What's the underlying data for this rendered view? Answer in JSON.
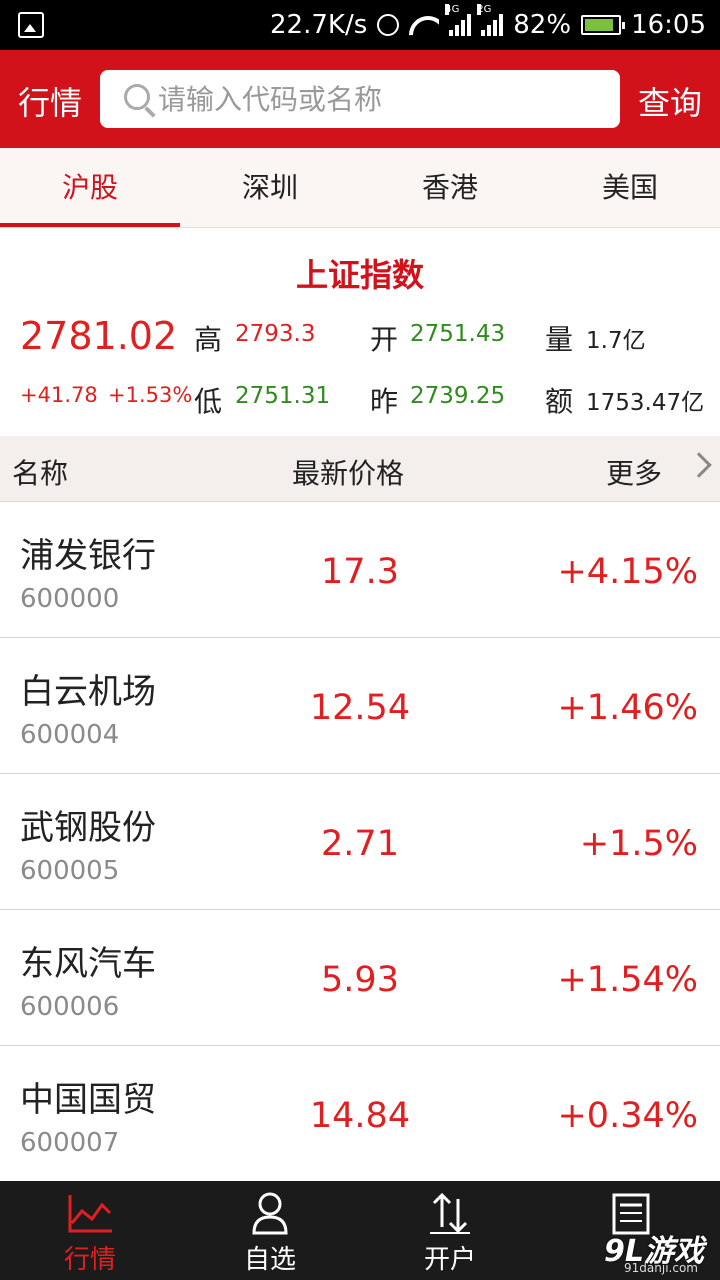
{
  "status_bar": {
    "speed": "22.7K/s",
    "net1": "4G",
    "net2": "2G",
    "battery": "82%",
    "time": "16:05"
  },
  "header": {
    "title": "行情",
    "search_placeholder": "请输入代码或名称",
    "query_label": "查询",
    "accent_color": "#d1121b"
  },
  "tabs": [
    {
      "label": "沪股",
      "active": true
    },
    {
      "label": "深圳",
      "active": false
    },
    {
      "label": "香港",
      "active": false
    },
    {
      "label": "美国",
      "active": false
    }
  ],
  "index": {
    "name": "上证指数",
    "price": "2781.02",
    "change": "+41.78",
    "change_pct": "+1.53%",
    "high_label": "高",
    "high": "2793.3",
    "low_label": "低",
    "low": "2751.31",
    "open_label": "开",
    "open": "2751.43",
    "prev_label": "昨",
    "prev": "2739.25",
    "volume_label": "量",
    "volume": "1.7亿",
    "amount_label": "额",
    "amount": "1753.47亿"
  },
  "list_header": {
    "name": "名称",
    "price": "最新价格",
    "more": "更多"
  },
  "stocks": [
    {
      "name": "浦发银行",
      "code": "600000",
      "price": "17.3",
      "pct": "+4.15%"
    },
    {
      "name": "白云机场",
      "code": "600004",
      "price": "12.54",
      "pct": "+1.46%"
    },
    {
      "name": "武钢股份",
      "code": "600005",
      "price": "2.71",
      "pct": "+1.5%"
    },
    {
      "name": "东风汽车",
      "code": "600006",
      "price": "5.93",
      "pct": "+1.54%"
    },
    {
      "name": "中国国贸",
      "code": "600007",
      "price": "14.84",
      "pct": "+0.34%"
    }
  ],
  "bottom_nav": [
    {
      "label": "行情",
      "icon": "chart-line-icon",
      "active": true
    },
    {
      "label": "自选",
      "icon": "user-icon",
      "active": false
    },
    {
      "label": "开户",
      "icon": "transfer-arrows-icon",
      "active": false
    },
    {
      "label": "",
      "icon": "news-icon",
      "active": false
    }
  ],
  "watermark": {
    "brand": "9L游戏",
    "domain": "91danji.com"
  }
}
